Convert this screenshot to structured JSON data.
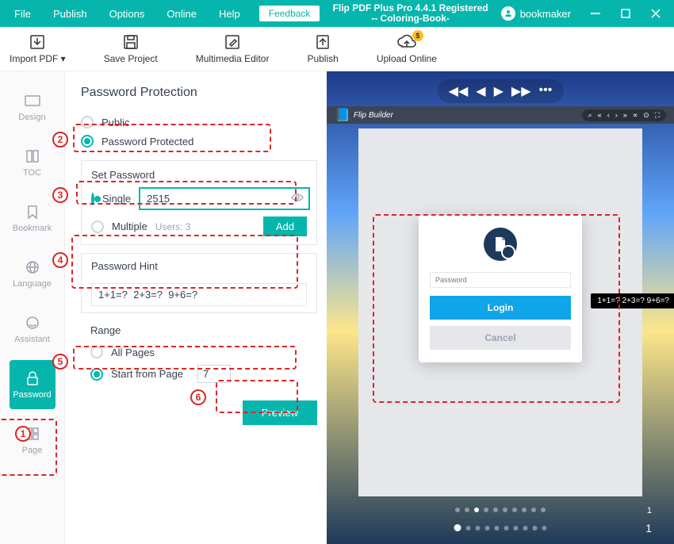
{
  "titlebar": {
    "menus": [
      "File",
      "Publish",
      "Options",
      "Online",
      "Help"
    ],
    "feedback": "Feedback",
    "title_line1": "Flip PDF Plus Pro 4.4.1 Registered",
    "title_line2": "-- Coloring-Book-",
    "username": "bookmaker"
  },
  "toolbar": {
    "import": "Import PDF ▾",
    "save": "Save Project",
    "multimedia": "Multimedia Editor",
    "publish": "Publish",
    "upload": "Upload Online"
  },
  "sidebar": {
    "items": [
      "Design",
      "TOC",
      "Bookmark",
      "Language",
      "Assistant",
      "Password",
      "Page"
    ]
  },
  "content": {
    "heading": "Password Protection",
    "public": "Public",
    "password_protected": "Password Protected",
    "set_password": "Set Password",
    "single": "Single",
    "single_value": "2515",
    "multiple": "Multiple",
    "users_count": "Users: 3",
    "add": "Add",
    "hint_label": "Password Hint",
    "hint_value": "1+1=?  2+3=?  9+6=?",
    "range": "Range",
    "all_pages": "All Pages",
    "start_from": "Start from Page",
    "start_page": "7",
    "preview": "Preview"
  },
  "preview": {
    "brand": "Flip Builder",
    "password_placeholder": "Password",
    "login": "Login",
    "cancel": "Cancel",
    "tooltip": "1+1=?  2+3=?  9+6=?",
    "page_num_top": "1",
    "page_num_bottom": "1"
  },
  "annotations": {
    "n1": "1",
    "n2": "2",
    "n3": "3",
    "n4": "4",
    "n5": "5",
    "n6": "6"
  }
}
